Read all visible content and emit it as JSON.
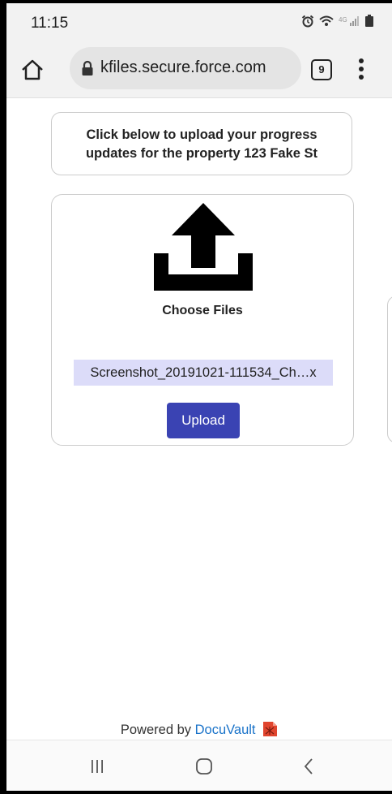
{
  "status_bar": {
    "time": "11:15",
    "icons": [
      "alarm-icon",
      "wifi-icon",
      "signal-icon",
      "battery-icon"
    ]
  },
  "browser": {
    "url": "kfiles.secure.force.com",
    "tab_count": "9",
    "icons": [
      "home-icon",
      "lock-icon",
      "tabs-icon",
      "more-vert-icon"
    ]
  },
  "page": {
    "info_line1": "Click below to upload your progress",
    "info_line2": "updates for the property 123 Fake St",
    "choose_files_label": "Choose Files",
    "selected_file": "Screenshot_20191021-111534_Ch…x",
    "upload_button": "Upload",
    "powered_by_prefix": "Powered by",
    "powered_by_brand": "DocuVault",
    "colors": {
      "upload_button": "#3a43b3",
      "file_highlight": "#dcdcf9",
      "brand_link": "#1a73c9"
    }
  },
  "nav_bar": {
    "icons": [
      "recents-icon",
      "home-nav-icon",
      "back-icon"
    ]
  }
}
